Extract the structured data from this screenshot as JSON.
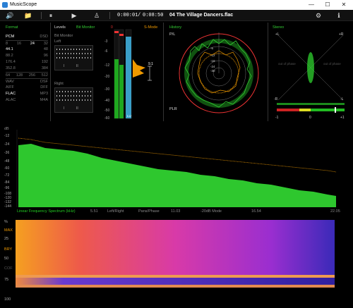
{
  "window": {
    "title": "MusicScope",
    "min_glyph": "—",
    "max_glyph": "☐",
    "close_glyph": "✕"
  },
  "toolbar": {
    "volume_icon": "🔊",
    "folder_icon": "📁",
    "pause_icon": "⏸",
    "play_icon": "▶",
    "metronome_icon": "♙",
    "time_current": "0:00:01",
    "time_sep": "/",
    "time_total": "0:08:50",
    "track_name": "04 The Village Dancers.flac",
    "settings_icon": "⚙",
    "info_icon": "ℹ"
  },
  "format": {
    "title": "Format",
    "pcm": "PCM",
    "dsd": "DSD",
    "bits": [
      "8",
      "16",
      "24",
      "32"
    ],
    "bits_active": "24",
    "rates_left": [
      "44.1",
      "88.2",
      "176.4",
      "352.8"
    ],
    "rates_right": [
      "48",
      "96",
      "192",
      "384"
    ],
    "dsd_rates": [
      "64",
      "128",
      "256",
      "512"
    ],
    "types_left": [
      "WAV",
      "AIFF",
      "FLAC",
      "ALAC"
    ],
    "types_right": [
      "DSF",
      "DFF",
      "MP3",
      "M4A"
    ],
    "active_rate": "44.1",
    "active_type": "FLAC"
  },
  "levels": {
    "title": "Levels",
    "bit_monitor": "Bit Monitor",
    "bit_monitor_sub": "Bit Monitor",
    "left": "Left",
    "right": "Right",
    "ticks_a": "I",
    "ticks_b": "II",
    "db_top": "0",
    "db_labels": [
      "-3",
      "-6",
      "-12",
      "-20",
      "-30",
      "-40",
      "-50",
      "-60"
    ],
    "s_mode": "S-Mode",
    "lu": "LU",
    "peak_value": "9.1",
    "axis_right": [
      "-3",
      "-6",
      "-12",
      "-20",
      "-30",
      "-40",
      "-50",
      "-60"
    ]
  },
  "history": {
    "title": "History",
    "pl": "P/L",
    "plr": "PLR",
    "rings": [
      "-6",
      "-12",
      "-18",
      "-24",
      "-30"
    ]
  },
  "stereo": {
    "title": "Stereo",
    "plus_l": "+L",
    "plus_r": "+R",
    "minus_r": "-R",
    "minus_l": "-L",
    "out_of_phase_left": "out of phase",
    "out_of_phase_right": "out of phase",
    "corr_min": "-1",
    "corr_mid": "0",
    "corr_max": "+1"
  },
  "spectrum": {
    "unit": "dB",
    "y_labels": [
      "-12",
      "-24",
      "-36",
      "-48",
      "-60",
      "-72",
      "-84",
      "-96",
      "-108",
      "-120",
      "-132",
      "-144"
    ],
    "x_labels": [
      "5.51",
      "11.03",
      "16.54",
      "22.05"
    ],
    "mode_label": "Linear Frequency Spectrum (kHz)",
    "left_right": "Left/Right",
    "pans_phase": "Pans/Phase",
    "db_mode": "-20dB Mode"
  },
  "spectrogram": {
    "unit": "%",
    "labels": [
      "MAX",
      "25",
      "BRY",
      "50",
      "COF",
      "75",
      "100"
    ]
  },
  "colors": {
    "green": "#33cc33",
    "red": "#e33333",
    "orange": "#ee9900",
    "bg": "#000000"
  }
}
